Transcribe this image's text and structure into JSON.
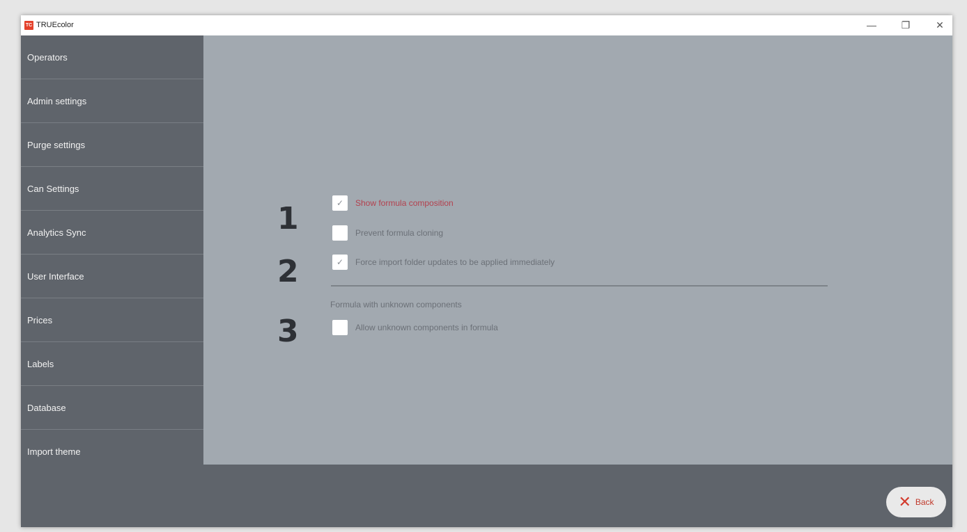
{
  "window": {
    "title": "TRUEcolor",
    "app_icon_text": "TC",
    "controls": {
      "minimize": "—",
      "restore": "❐",
      "close": "✕"
    }
  },
  "sidebar": {
    "items": [
      {
        "label": "Operators"
      },
      {
        "label": "Admin settings"
      },
      {
        "label": "Purge settings"
      },
      {
        "label": "Can Settings"
      },
      {
        "label": "Analytics Sync"
      },
      {
        "label": "User Interface"
      },
      {
        "label": "Prices"
      },
      {
        "label": "Labels"
      },
      {
        "label": "Database"
      },
      {
        "label": "Import theme"
      }
    ]
  },
  "annotations": [
    "1",
    "2",
    "3"
  ],
  "options": [
    {
      "label": "Show formula composition",
      "checked": true,
      "check_glyph": "✓"
    },
    {
      "label": "Prevent formula cloning",
      "checked": false,
      "check_glyph": ""
    },
    {
      "label": "Force import folder updates to be applied immediately",
      "checked": true,
      "check_glyph": "✓"
    }
  ],
  "unknown_section": {
    "title": "Formula with unknown components",
    "option": {
      "label": "Allow unknown components in formula",
      "checked": false,
      "check_glyph": ""
    }
  },
  "footer": {
    "back_icon": "✕",
    "back_label": "Back"
  },
  "colors": {
    "sidebar_bg": "#5f646b",
    "content_bg": "#a2a9b0",
    "highlight_text": "#b3414e",
    "back_accent": "#d33a2c"
  }
}
